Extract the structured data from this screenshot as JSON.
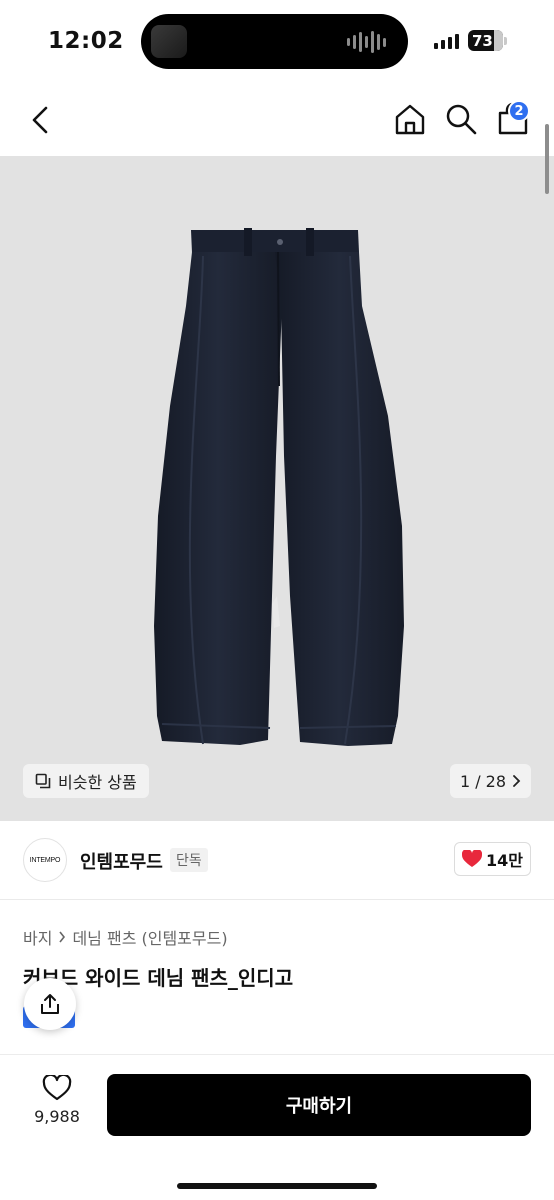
{
  "status_bar": {
    "time": "12:02",
    "battery": "73"
  },
  "header": {
    "cart_badge": "2"
  },
  "gallery": {
    "similar_label": "비슷한 상품",
    "pager": "1 / 28"
  },
  "brand": {
    "logo_text": "INTEMPO",
    "name": "인템포무드",
    "badge": "단독",
    "like_count": "14만"
  },
  "product": {
    "breadcrumb": [
      "바지",
      "데님 팬츠 (인템포무드)"
    ],
    "title": "커브드 와이드 데님 팬츠_인디고"
  },
  "bottom_bar": {
    "wish_count": "9,988",
    "buy_label": "구매하기"
  },
  "colors": {
    "accent": "#2f6ff0",
    "heart": "#e8283c",
    "denim": "#1e2433"
  }
}
